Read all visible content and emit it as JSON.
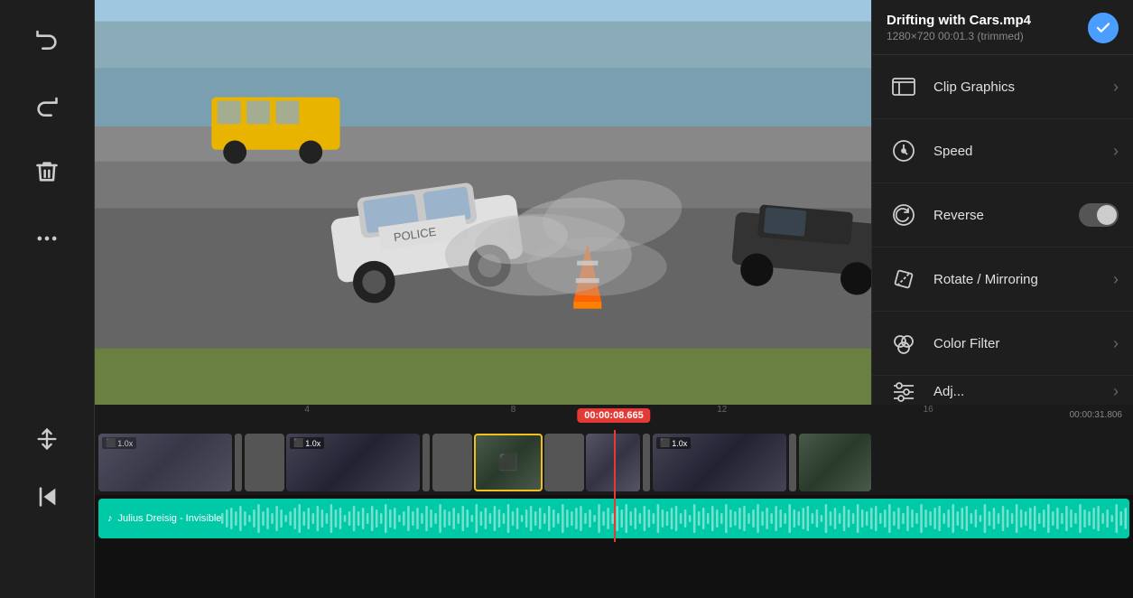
{
  "file": {
    "name": "Drifting with Cars.mp4",
    "meta": "1280×720  00:01.3 (trimmed)"
  },
  "toolbar": {
    "undo_label": "Undo",
    "redo_label": "Redo",
    "delete_label": "Delete",
    "more_label": "More"
  },
  "timeline_toolbar": {
    "adjust_label": "Adjust",
    "back_label": "Back to start"
  },
  "menu": {
    "items": [
      {
        "id": "clip-graphics",
        "label": "Clip Graphics",
        "has_chevron": true
      },
      {
        "id": "speed",
        "label": "Speed",
        "has_chevron": true
      },
      {
        "id": "reverse",
        "label": "Reverse",
        "has_toggle": true
      },
      {
        "id": "rotate-mirroring",
        "label": "Rotate / Mirroring",
        "has_chevron": true
      },
      {
        "id": "color-filter",
        "label": "Color Filter",
        "has_chevron": true
      },
      {
        "id": "adjustment",
        "label": "Adjustment",
        "has_chevron": true
      }
    ]
  },
  "timeline": {
    "current_time": "00:00:08.665",
    "end_time": "00:00:31.806",
    "markers": [
      "4",
      "8",
      "12",
      "16"
    ],
    "audio_track": "Julius Dreisig - Invisible"
  },
  "clips": [
    {
      "id": "clip1",
      "label": "1.0x",
      "selected": false
    },
    {
      "id": "clip2",
      "label": "",
      "selected": false
    },
    {
      "id": "clip3",
      "label": "1.0x",
      "selected": false
    },
    {
      "id": "clip4",
      "label": "",
      "selected": false
    },
    {
      "id": "clip5",
      "label": "",
      "selected": true
    },
    {
      "id": "clip6",
      "label": "",
      "selected": false
    },
    {
      "id": "clip7",
      "label": "",
      "selected": false
    },
    {
      "id": "clip8",
      "label": "1.0x",
      "selected": false
    }
  ]
}
